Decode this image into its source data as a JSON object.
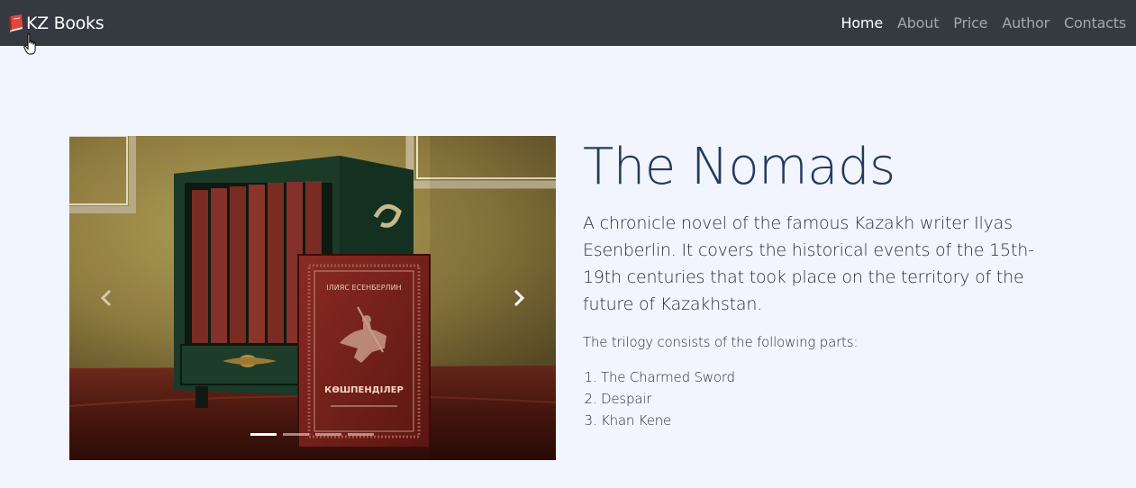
{
  "navbar": {
    "brand": "KZ Books",
    "links": [
      {
        "label": "Home",
        "active": true
      },
      {
        "label": "About",
        "active": false
      },
      {
        "label": "Price",
        "active": false
      },
      {
        "label": "Author",
        "active": false
      },
      {
        "label": "Contacts",
        "active": false
      }
    ]
  },
  "carousel": {
    "slide_count": 4,
    "active_index": 0,
    "book_cover": {
      "author": "ІЛИЯС ЕСЕНБЕРЛИН",
      "title": "КӨШПЕНДІЛЕР"
    }
  },
  "book": {
    "title": "The Nomads",
    "description": "A chronicle novel of the famous Kazakh writer Ilyas Esenberlin. It covers the historical events of the 15th-19th centuries that took place on the territory of the future of Kazakhstan.",
    "parts_intro": "The trilogy consists of the following parts:",
    "parts": [
      "The Charmed Sword",
      "Despair",
      "Khan Kene"
    ]
  },
  "colors": {
    "navbar_bg": "#343a40",
    "page_bg": "#f2f5fd",
    "title": "#243a5e"
  },
  "icons": {
    "brand": "book-icon",
    "prev": "chevron-left-icon",
    "next": "chevron-right-icon",
    "cursor": "hand-pointer-icon"
  }
}
